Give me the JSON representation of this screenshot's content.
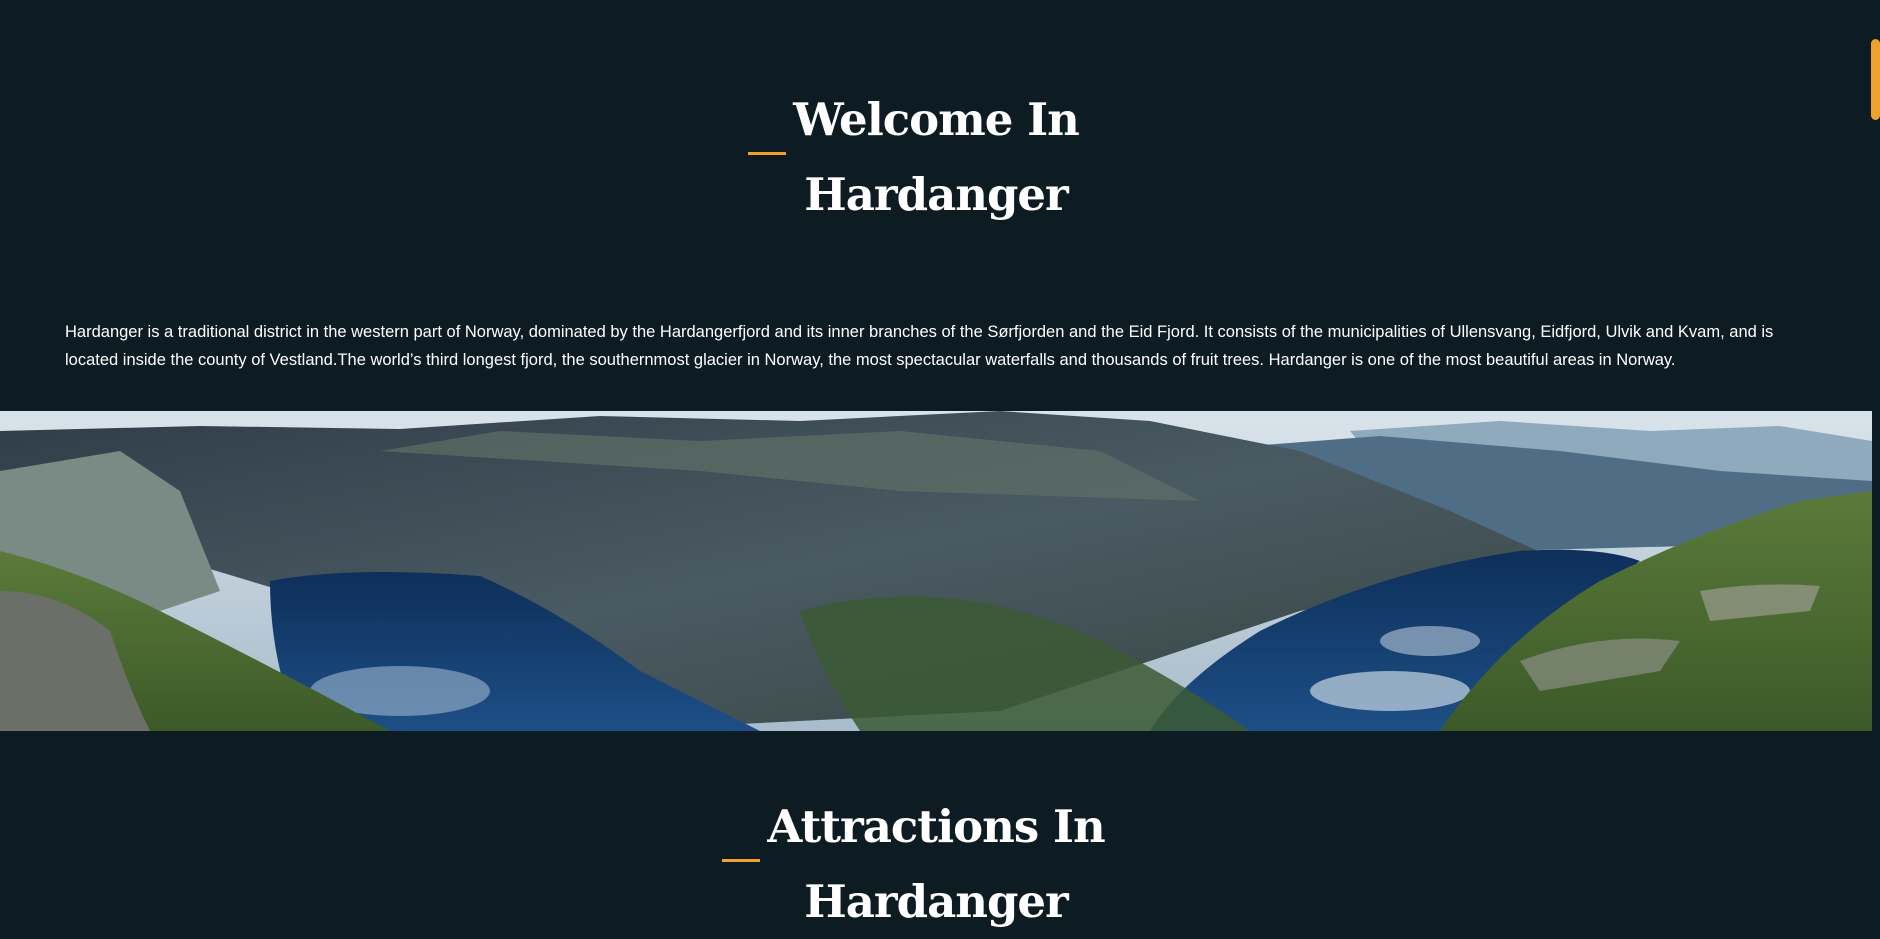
{
  "welcome": {
    "title_line1": "Welcome In",
    "title_line2": "Hardanger"
  },
  "intro": {
    "text": "Hardanger is a traditional district in the western part of Norway, dominated by the Hardangerfjord and its inner branches of the Sørfjorden and the Eid Fjord. It consists of the municipalities of Ullensvang, Eidfjord, Ulvik and Kvam, and is located inside the county of Vestland.The world’s third longest fjord, the southernmost glacier in Norway, the most spectacular waterfalls and thousands of fruit trees. Hardanger is one of the most beautiful areas in Norway."
  },
  "attractions": {
    "title_line1": "Attractions In",
    "title_line2": "Hardanger"
  },
  "colors": {
    "background": "#0d1b22",
    "accent": "#f0a12a",
    "text": "#ffffff"
  }
}
